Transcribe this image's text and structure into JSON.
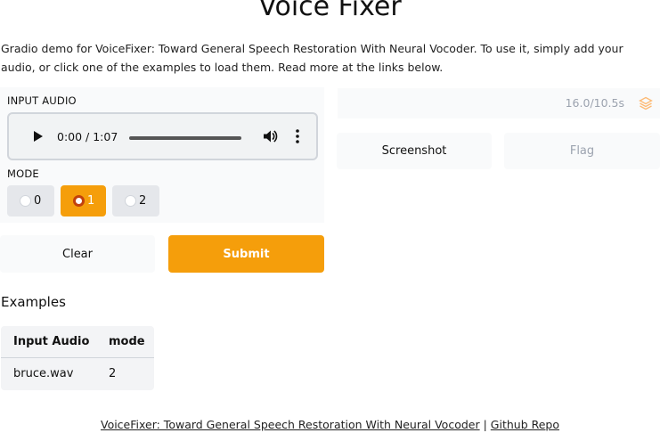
{
  "page": {
    "title": "Voice Fixer",
    "description": "Gradio demo for VoiceFixer: Toward General Speech Restoration With Neural Vocoder. To use it, simply add your audio, or click one of the examples to load them. Read more at the links below."
  },
  "input": {
    "audio_label": "INPUT AUDIO",
    "player_time": "0:00 / 1:07",
    "mode_label": "MODE",
    "mode_options": [
      "0",
      "1",
      "2"
    ],
    "mode_selected": "1"
  },
  "actions": {
    "clear_label": "Clear",
    "submit_label": "Submit",
    "screenshot_label": "Screenshot",
    "flag_label": "Flag"
  },
  "output": {
    "timing": "16.0/10.5s"
  },
  "examples": {
    "title": "Examples",
    "headers": [
      "Input Audio",
      "mode"
    ],
    "rows": [
      [
        "bruce.wav",
        "2"
      ]
    ]
  },
  "footer": {
    "link1": "VoiceFixer: Toward General Speech Restoration With Neural Vocoder",
    "separator": "|",
    "link2": "Github Repo"
  },
  "colors": {
    "accent": "#f59e0b",
    "panel": "#f9fafb"
  },
  "icons": [
    "play-icon",
    "volume-icon",
    "more-vertical-icon",
    "layers-icon"
  ]
}
